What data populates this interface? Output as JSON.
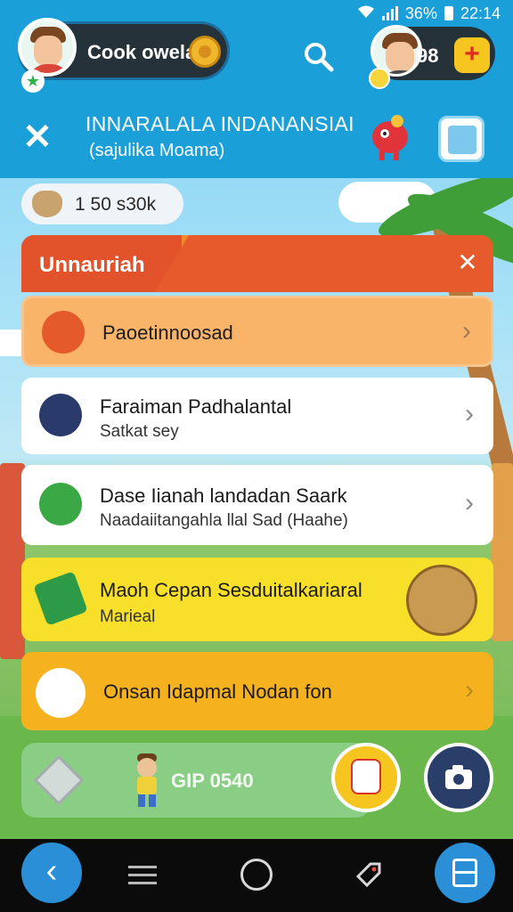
{
  "status_bar": {
    "battery": "36%",
    "time": "22:14"
  },
  "header": {
    "profile_name": "Cook owela",
    "right_count": "98",
    "plus_label": "+",
    "title_line1": "INNARALALA INDANANSIAI",
    "title_line2": "(sajulika Moama)",
    "close_label": "✕"
  },
  "coin_chip": {
    "value": "1 50 s30k"
  },
  "panel": {
    "title": "Unnauriah",
    "close_label": "✕",
    "items": [
      {
        "title": "Paoetinnoosad",
        "subtitle": ""
      },
      {
        "title": "Faraiman Padhalantal",
        "subtitle": "Satkat sey"
      },
      {
        "title": "Dase Iianah landadan Saark",
        "subtitle": "Naadaiitangahla llal Sad (Haahe)"
      },
      {
        "title": "Maoh Cepan Sesduitalkariaral",
        "subtitle": "Marieal"
      },
      {
        "title": "Onsan Idapmal Nodan fon",
        "subtitle": ""
      }
    ],
    "chevron": "›"
  },
  "bottom_card": {
    "label": "GIP 0540"
  },
  "nav": {
    "back": "‹"
  },
  "colors": {
    "header_blue": "#1a9fd9",
    "panel_orange": "#f28a2b",
    "row_yellow": "#f8df2a",
    "row_amber": "#f6b11f"
  },
  "icons": [
    "search-icon",
    "plus-icon",
    "close-icon",
    "document-icon",
    "chevron-right-icon",
    "camera-icon",
    "back-icon",
    "menu-icon",
    "home-icon",
    "tag-icon",
    "recent-apps-icon"
  ]
}
